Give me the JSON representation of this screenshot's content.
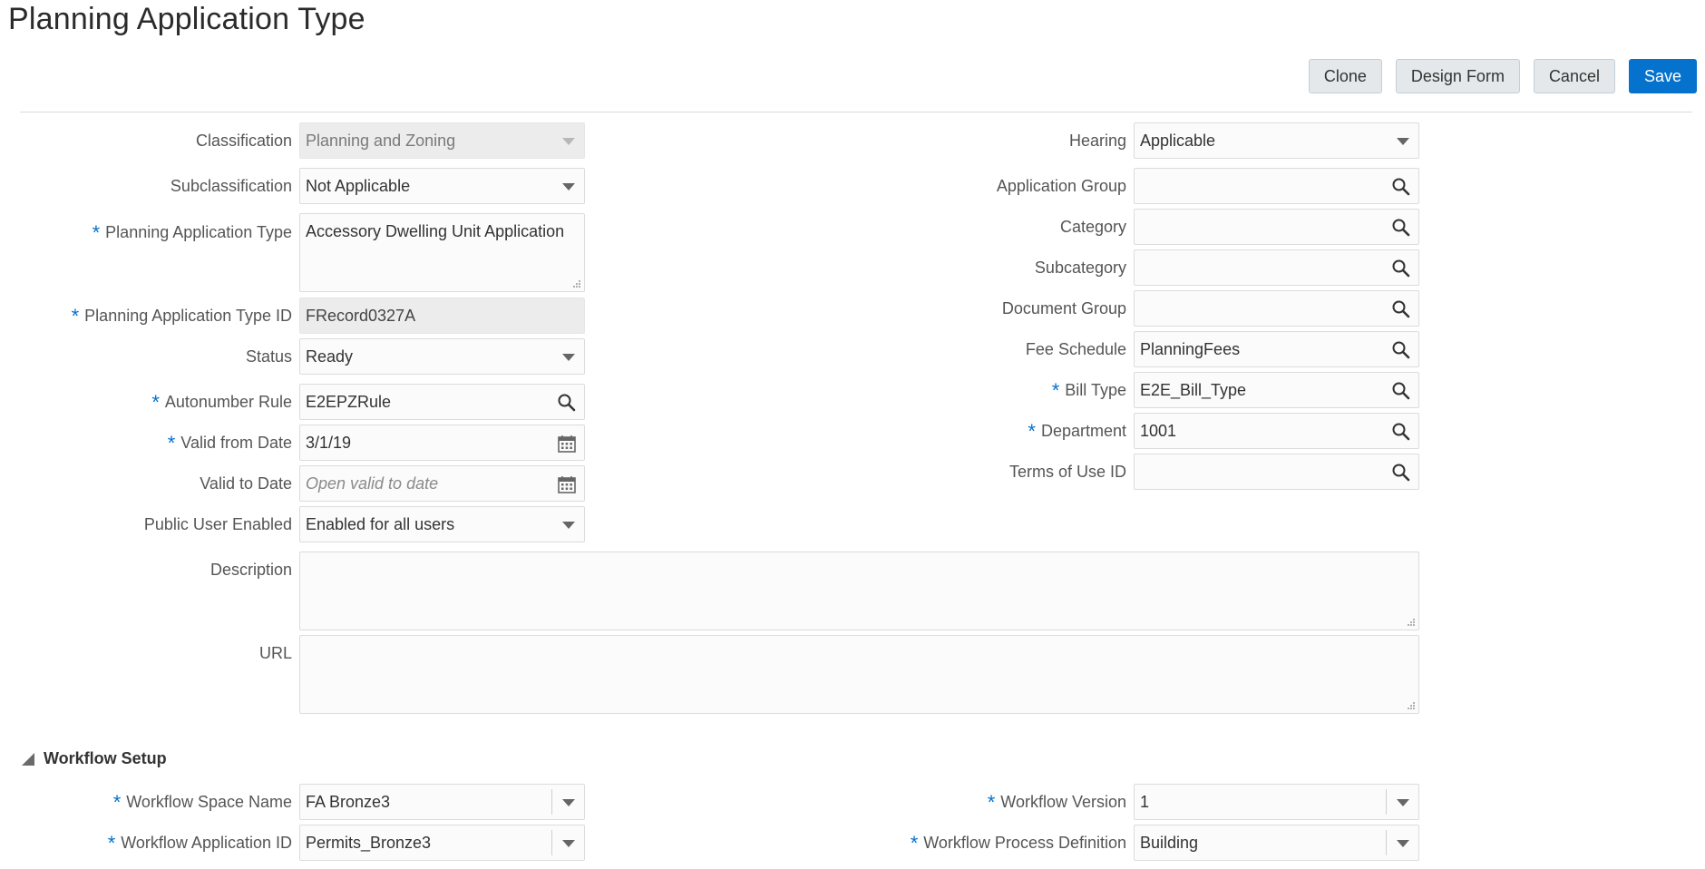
{
  "page": {
    "title": "Planning Application Type"
  },
  "toolbar": {
    "clone": "Clone",
    "design_form": "Design Form",
    "cancel": "Cancel",
    "save": "Save"
  },
  "form_left": {
    "classification": {
      "label": "Classification",
      "value": "Planning and Zoning"
    },
    "subclassification": {
      "label": "Subclassification",
      "value": "Not Applicable"
    },
    "type": {
      "label": "Planning Application Type",
      "value": "Accessory Dwelling Unit Application"
    },
    "type_id": {
      "label": "Planning Application Type ID",
      "value": "FRecord0327A"
    },
    "status": {
      "label": "Status",
      "value": "Ready"
    },
    "autonumber": {
      "label": "Autonumber Rule",
      "value": "E2EPZRule"
    },
    "valid_from": {
      "label": "Valid from Date",
      "value": "3/1/19"
    },
    "valid_to": {
      "label": "Valid to Date",
      "placeholder": "Open valid to date"
    },
    "public_user": {
      "label": "Public User Enabled",
      "value": "Enabled for all users"
    }
  },
  "form_right": {
    "hearing": {
      "label": "Hearing",
      "value": "Applicable"
    },
    "application_group": {
      "label": "Application Group",
      "value": ""
    },
    "category": {
      "label": "Category",
      "value": ""
    },
    "subcategory": {
      "label": "Subcategory",
      "value": ""
    },
    "document_group": {
      "label": "Document Group",
      "value": ""
    },
    "fee_schedule": {
      "label": "Fee Schedule",
      "value": "PlanningFees"
    },
    "bill_type": {
      "label": "Bill Type",
      "value": "E2E_Bill_Type"
    },
    "department": {
      "label": "Department",
      "value": "1001"
    },
    "terms_of_use": {
      "label": "Terms of Use ID",
      "value": ""
    }
  },
  "form_wide": {
    "description": {
      "label": "Description",
      "value": ""
    },
    "url": {
      "label": "URL",
      "value": ""
    }
  },
  "workflow": {
    "section_title": "Workflow Setup",
    "space_name": {
      "label": "Workflow Space Name",
      "value": "FA Bronze3"
    },
    "application_id": {
      "label": "Workflow Application ID",
      "value": "Permits_Bronze3"
    },
    "version": {
      "label": "Workflow Version",
      "value": "1"
    },
    "process_definition": {
      "label": "Workflow Process Definition",
      "value": "Building"
    }
  },
  "required_marker": "*",
  "colors": {
    "accent": "#0572ce",
    "required": "#0572ce",
    "button_bg": "#e4e8ea"
  }
}
